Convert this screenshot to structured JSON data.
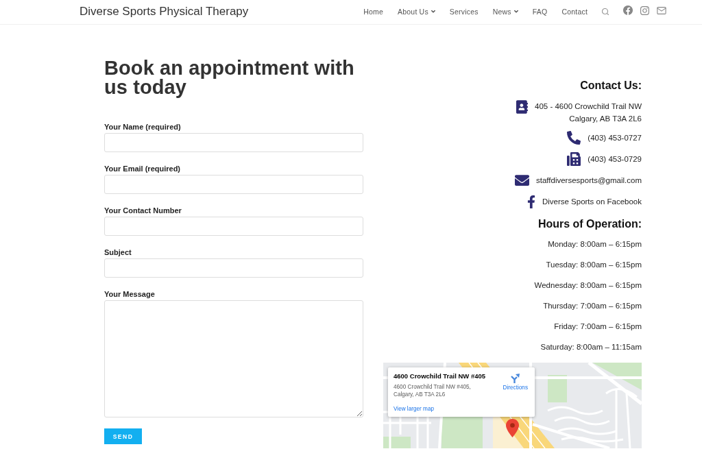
{
  "header": {
    "logo": "Diverse Sports Physical Therapy",
    "nav": [
      {
        "label": "Home",
        "kind": "link"
      },
      {
        "label": "About Us",
        "kind": "dropdown"
      },
      {
        "label": "Services",
        "kind": "link"
      },
      {
        "label": "News",
        "kind": "dropdown"
      },
      {
        "label": "FAQ",
        "kind": "link"
      },
      {
        "label": "Contact",
        "kind": "link"
      }
    ]
  },
  "form": {
    "title": "Book an appointment with us today",
    "fields": [
      {
        "label": "Your Name (required)",
        "kind": "text"
      },
      {
        "label": "Your Email (required)",
        "kind": "text"
      },
      {
        "label": "Your Contact Number",
        "kind": "text"
      },
      {
        "label": "Subject",
        "kind": "text"
      },
      {
        "label": "Your Message",
        "kind": "textarea"
      }
    ],
    "submit": "SEND"
  },
  "contact": {
    "title": "Contact Us:",
    "items": [
      {
        "kind": "address",
        "lines": [
          "405 - 4600 Crowchild Trail NW",
          "Calgary, AB T3A 2L6"
        ]
      },
      {
        "kind": "phone",
        "lines": [
          "(403) 453-0727"
        ]
      },
      {
        "kind": "fax",
        "lines": [
          "(403) 453-0729"
        ]
      },
      {
        "kind": "email",
        "lines": [
          "staffdiversesports@gmail.com"
        ]
      },
      {
        "kind": "facebook",
        "lines": [
          "Diverse Sports on Facebook"
        ]
      }
    ]
  },
  "hours": {
    "title": "Hours of Operation:",
    "days": [
      "Monday: 8:00am – 6:15pm",
      "Tuesday: 8:00am – 6:15pm",
      "Wednesday: 8:00am – 6:15pm",
      "Thursday: 7:00am – 6:15pm",
      "Friday: 7:00am – 6:15pm",
      "Saturday: 8:00am – 11:15am"
    ]
  },
  "map": {
    "card": {
      "title": "4600 Crowchild Trail NW #405",
      "address_lines": [
        "4600 Crowchild Trail NW #405,",
        "Calgary, AB T3A 2L6"
      ],
      "directions": "Directions",
      "larger_map": "View larger map"
    }
  }
}
